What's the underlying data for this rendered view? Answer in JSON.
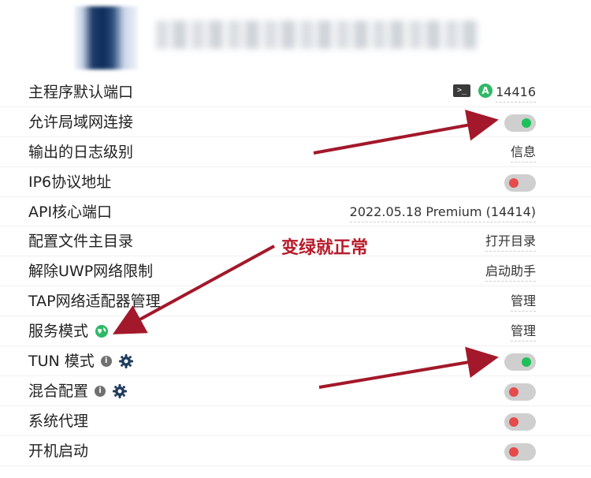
{
  "header": {},
  "settings": {
    "main_port": {
      "label": "主程序默认端口",
      "value": "14416",
      "auto_badge": "A"
    },
    "lan": {
      "label": "允许局域网连接",
      "state": "on"
    },
    "log_level": {
      "label": "输出的日志级别",
      "value": "信息"
    },
    "ipv6": {
      "label": "IP6协议地址",
      "state": "off"
    },
    "api_port": {
      "label": "API核心端口",
      "value": "2022.05.18 Premium (14414)"
    },
    "config_dir": {
      "label": "配置文件主目录",
      "value": "打开目录"
    },
    "uwp": {
      "label": "解除UWP网络限制",
      "value": "启动助手"
    },
    "tap": {
      "label": "TAP网络适配器管理",
      "value": "管理"
    },
    "service_mode": {
      "label": "服务模式",
      "value": "管理"
    },
    "tun": {
      "label": "TUN 模式",
      "state": "on"
    },
    "mixin": {
      "label": "混合配置",
      "state": "off"
    },
    "system_proxy": {
      "label": "系统代理",
      "state": "off"
    },
    "autostart": {
      "label": "开机启动",
      "state": "off"
    }
  },
  "annotation": {
    "text": "变绿就正常"
  },
  "colors": {
    "on": "#1ec05a",
    "off": "#e64a4a",
    "annotation": "#b81a2a"
  }
}
